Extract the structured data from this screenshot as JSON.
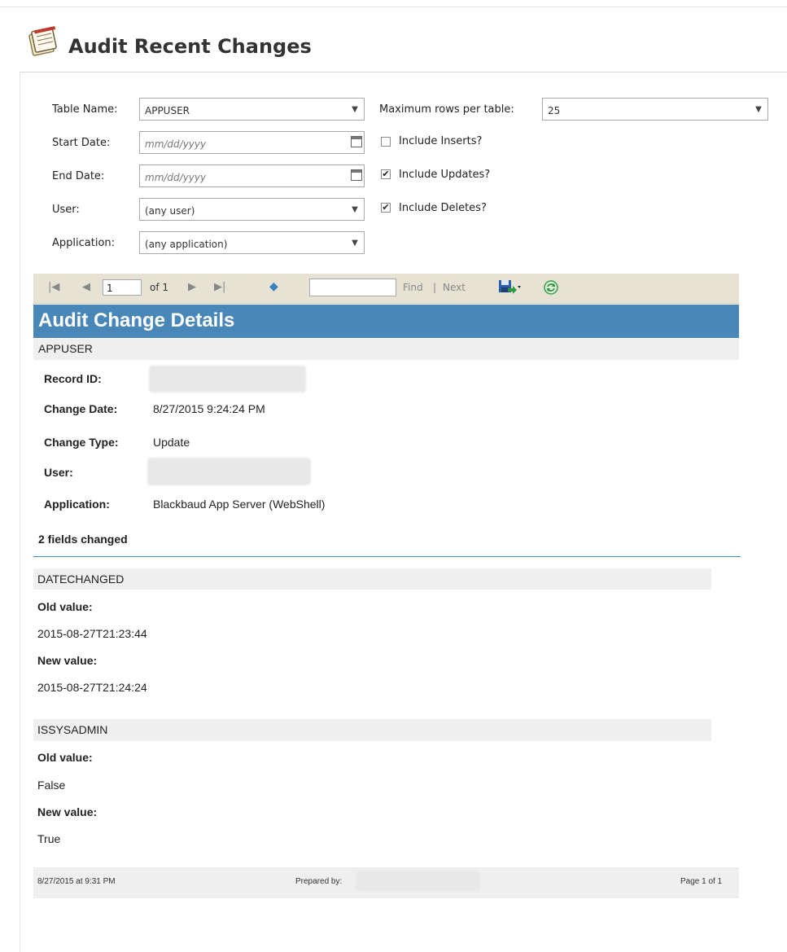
{
  "title": "Audit Recent Changes",
  "form": {
    "table_name_label": "Table Name:",
    "table_name_value": "APPUSER",
    "start_date_label": "Start Date:",
    "start_date_placeholder": "mm/dd/yyyy",
    "end_date_label": "End Date:",
    "end_date_placeholder": "mm/dd/yyyy",
    "user_label": "User:",
    "user_value": "(any user)",
    "application_label": "Application:",
    "application_value": "(any application)",
    "max_rows_label": "Maximum rows per table:",
    "max_rows_value": "25",
    "include_inserts_label": "Include Inserts?",
    "include_inserts_checked": false,
    "include_updates_label": "Include Updates?",
    "include_updates_checked": true,
    "include_deletes_label": "Include Deletes?",
    "include_deletes_checked": true
  },
  "toolbar": {
    "page_value": "1",
    "page_of": "of 1",
    "find_label": "Find",
    "separator": "|",
    "next_label": "Next"
  },
  "report": {
    "header": "Audit Change Details",
    "table_name": "APPUSER",
    "record_id_label": "Record ID:",
    "change_date_label": "Change Date:",
    "change_date_value": "8/27/2015 9:24:24 PM",
    "change_type_label": "Change Type:",
    "change_type_value": "Update",
    "user_label": "User:",
    "application_label": "Application:",
    "application_value": "Blackbaud App Server (WebShell)",
    "fields_changed": "2 fields changed",
    "fields": [
      {
        "name": "DATECHANGED",
        "old_label": "Old value:",
        "old_value": "2015-08-27T21:23:44",
        "new_label": "New value:",
        "new_value": "2015-08-27T21:24:24"
      },
      {
        "name": "ISSYSADMIN",
        "old_label": "Old value:",
        "old_value": "False",
        "new_label": "New value:",
        "new_value": "True"
      }
    ]
  },
  "footer": {
    "date": "8/27/2015 at 9:31 PM",
    "prepared_by_label": "Prepared by:",
    "page": "Page 1 of 1"
  }
}
